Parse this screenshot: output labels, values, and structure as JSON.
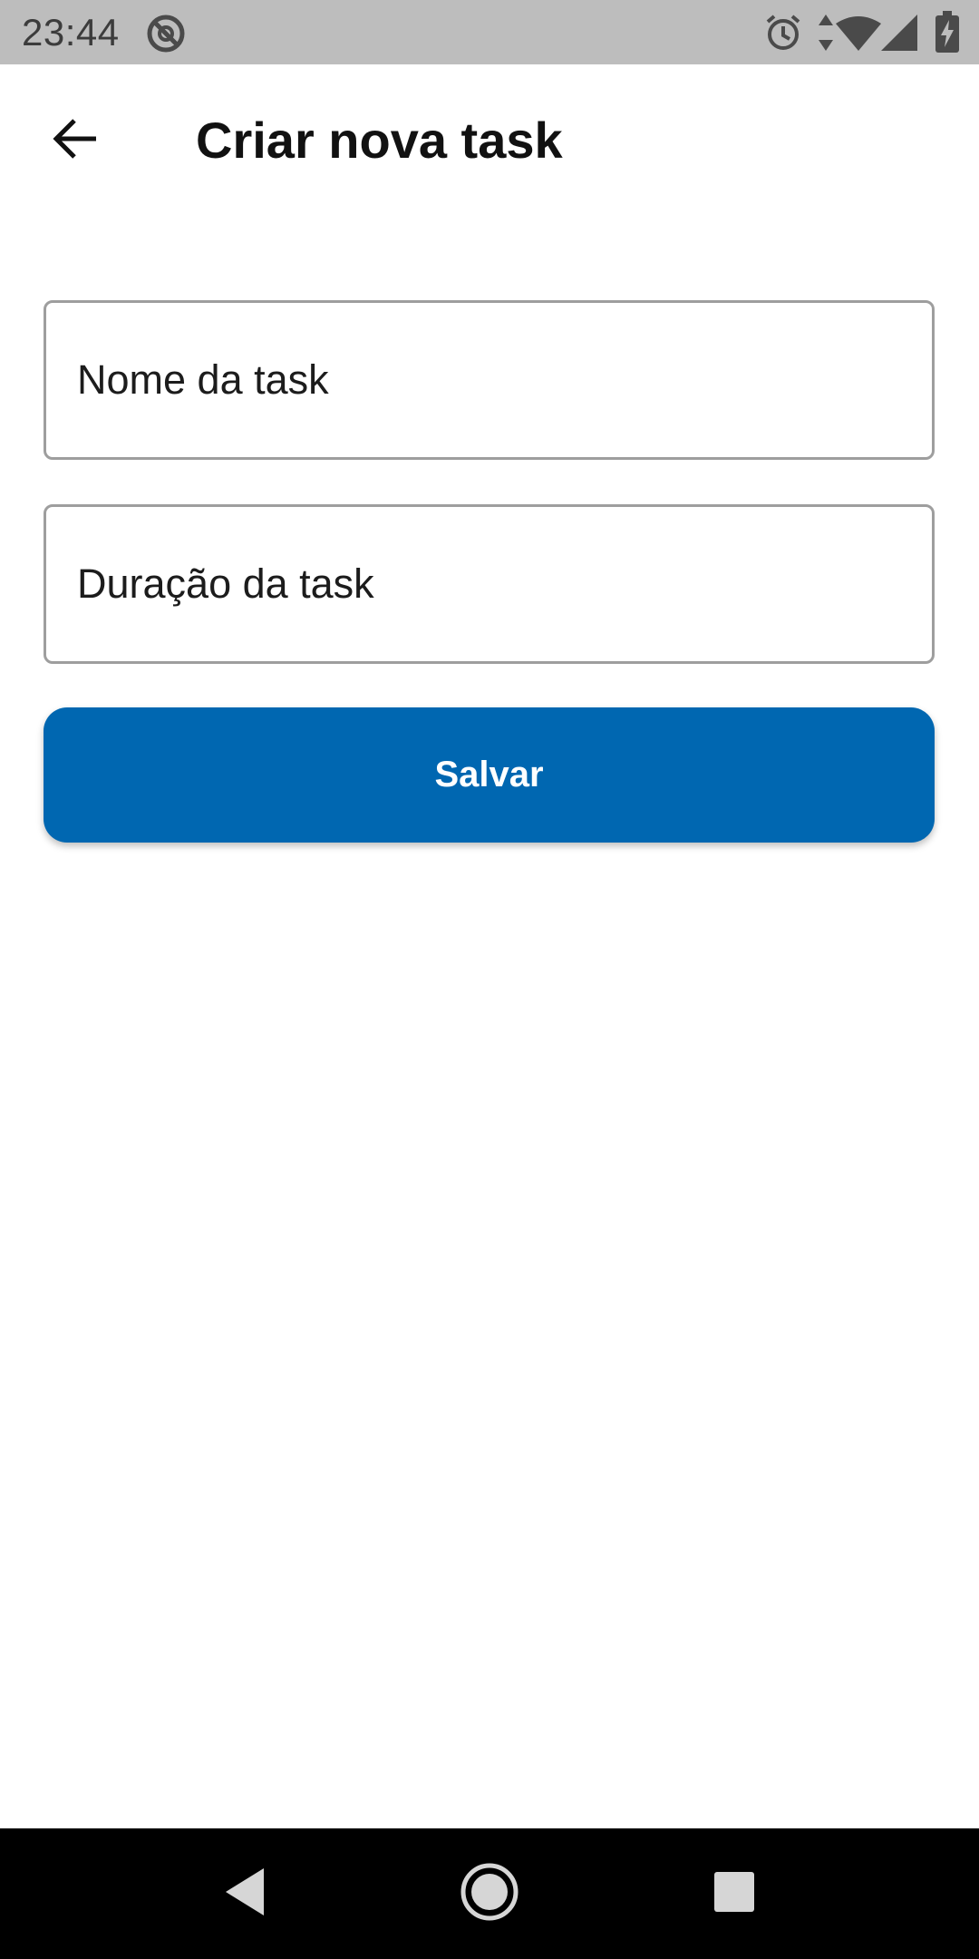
{
  "status_bar": {
    "time": "23:44",
    "icons": [
      "do-not-disturb-icon",
      "alarm-icon",
      "data-arrows-icon",
      "wifi-icon",
      "cell-signal-icon",
      "battery-charging-icon"
    ]
  },
  "app_bar": {
    "back_icon": "arrow-back-icon",
    "title": "Criar nova task"
  },
  "form": {
    "name_field": {
      "placeholder": "Nome da task",
      "value": ""
    },
    "duration_field": {
      "placeholder": "Duração da task",
      "value": ""
    },
    "save_label": "Salvar"
  },
  "colors": {
    "primary": "#0067b1",
    "status_bar_bg": "#bdbdbd",
    "field_border": "#9e9e9e",
    "nav_bar_bg": "#000000"
  },
  "nav_bar": {
    "icons": [
      "nav-back-icon",
      "nav-home-icon",
      "nav-recents-icon"
    ]
  }
}
